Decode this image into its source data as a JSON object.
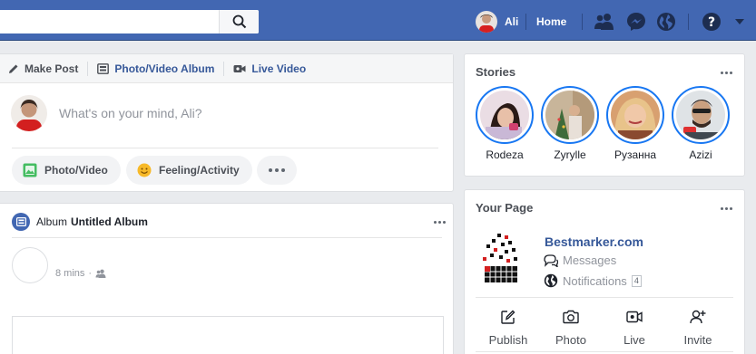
{
  "header": {
    "search_placeholder": "",
    "profile_name": "Ali",
    "home_label": "Home",
    "brand_color": "#4267b2"
  },
  "composer": {
    "tabs": [
      {
        "label": "Make Post",
        "icon": "pencil-icon"
      },
      {
        "label": "Photo/Video Album",
        "icon": "album-icon"
      },
      {
        "label": "Live Video",
        "icon": "video-camera-icon"
      }
    ],
    "placeholder": "What's on your mind, Ali?",
    "actions": [
      {
        "label": "Photo/Video",
        "icon": "photo-icon"
      },
      {
        "label": "Feeling/Activity",
        "icon": "smiley-icon"
      }
    ]
  },
  "album_post": {
    "prefix": "Album",
    "title": "Untitled Album",
    "time": "8 mins"
  },
  "stories": {
    "title": "Stories",
    "items": [
      {
        "name": "Rodeza"
      },
      {
        "name": "Zyrylle"
      },
      {
        "name": "Рузанна"
      },
      {
        "name": "Azizi"
      }
    ]
  },
  "your_page": {
    "title": "Your Page",
    "page_name": "Bestmarker.com",
    "messages_label": "Messages",
    "notifications_label": "Notifications",
    "notifications_count": "4",
    "actions": [
      {
        "label": "Publish",
        "icon": "edit-icon"
      },
      {
        "label": "Photo",
        "icon": "camera-icon"
      },
      {
        "label": "Live",
        "icon": "live-video-icon"
      },
      {
        "label": "Invite",
        "icon": "invite-user-icon"
      }
    ]
  }
}
